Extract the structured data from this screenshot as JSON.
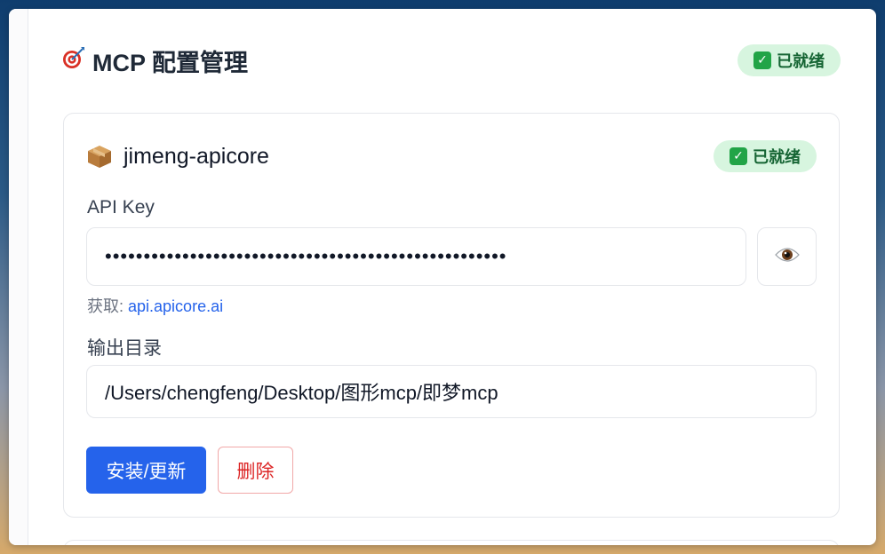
{
  "header": {
    "title": "MCP 配置管理",
    "status_label": "已就绪"
  },
  "card": {
    "name": "jimeng-apicore",
    "status_label": "已就绪",
    "api_key": {
      "label": "API Key",
      "masked_value": "••••••••••••••••••••••••••••••••••••••••••••••••••••",
      "hint_prefix": "获取: ",
      "hint_link": "api.apicore.ai"
    },
    "output_dir": {
      "label": "输出目录",
      "value": "/Users/chengfeng/Desktop/图形mcp/即梦mcp"
    },
    "buttons": {
      "install": "安装/更新",
      "delete": "删除"
    }
  },
  "icons": {
    "title_icon": "target-dart-icon",
    "package_icon": "package-box-icon",
    "eye_icon": "eye-icon",
    "check_icon": "check-mark-icon"
  },
  "colors": {
    "accent": "#2563eb",
    "success_bg": "#d7f5df",
    "success_text": "#166534",
    "danger": "#dc2626"
  }
}
